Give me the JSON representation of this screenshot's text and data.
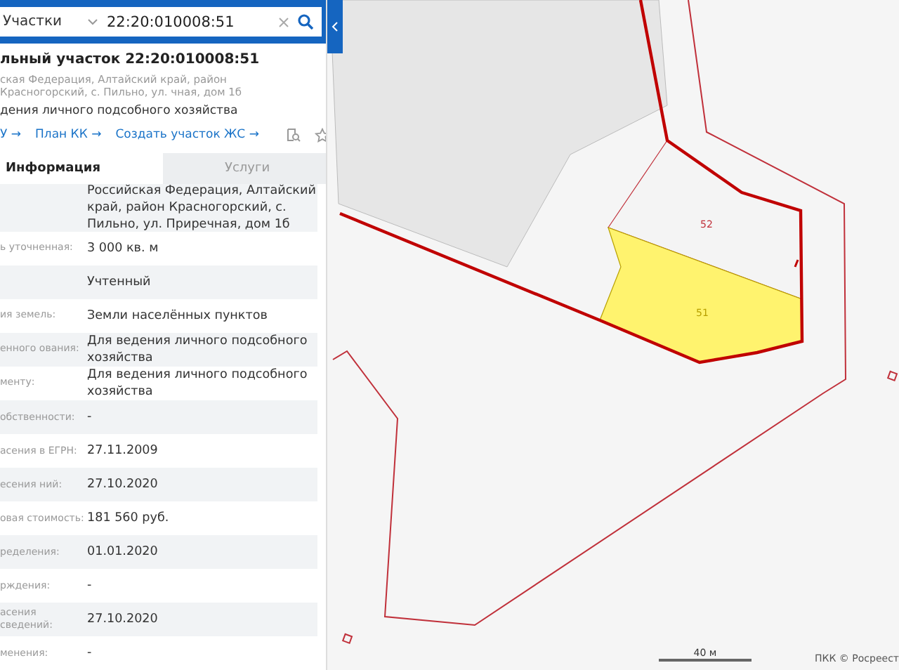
{
  "search": {
    "category": "Участки",
    "value": "22:20:010008:51"
  },
  "parcel": {
    "title": "льный участок 22:20:010008:51",
    "address": "ская Федерация, Алтайский край, район Красногорский, с. Пильно, ул. чная, дом 1б",
    "purpose": "дения личного подсобного хозяйства"
  },
  "links": [
    "У →",
    "План КК →",
    "Создать участок ЖС →"
  ],
  "tabs": [
    {
      "label": "Информация",
      "selected": true
    },
    {
      "label": "Услуги",
      "selected": false
    }
  ],
  "rows": [
    {
      "label": "",
      "value": "Российская Федерация, Алтайский край, район Красногорский, с. Пильно, ул. Приречная, дом 1б"
    },
    {
      "label": "ь уточненная:",
      "value": "3 000 кв. м"
    },
    {
      "label": "",
      "value": "Учтенный"
    },
    {
      "label": "ия земель:",
      "value": "Земли населённых пунктов"
    },
    {
      "label": "енного ования:",
      "value": "Для ведения личного подсобного хозяйства"
    },
    {
      "label": "менту:",
      "value": "Для ведения личного подсобного хозяйства"
    },
    {
      "label": "обственности:",
      "value": "-"
    },
    {
      "label": "асения в ЕГРН:",
      "value": "27.11.2009"
    },
    {
      "label": "есения ний:",
      "value": "27.10.2020"
    },
    {
      "label": "овая стоимость:",
      "value": "181 560 руб."
    },
    {
      "label": "ределения:",
      "value": "01.01.2020"
    },
    {
      "label": "рждения:",
      "value": "-"
    },
    {
      "label": "асения сведений:",
      "value": "27.10.2020"
    },
    {
      "label": "менения:",
      "value": "-"
    }
  ],
  "map": {
    "parcels": [
      {
        "label": "52",
        "selected": false
      },
      {
        "label": "51",
        "selected": true
      }
    ],
    "scale": "40 м",
    "attribution": "ПКК © Росреест"
  }
}
